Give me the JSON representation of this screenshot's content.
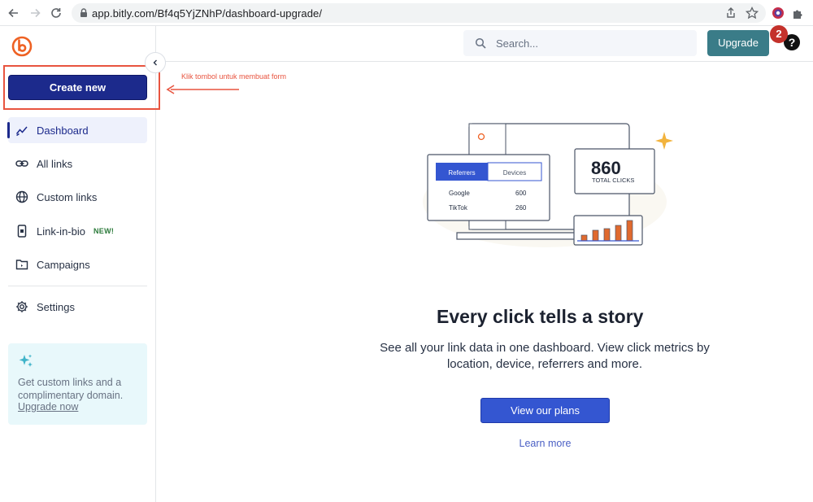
{
  "browser": {
    "url": "app.bitly.com/Bf4q5YjZNhP/dashboard-upgrade/"
  },
  "sidebar": {
    "create_label": "Create new",
    "collapse_icon": "chevron-left-icon",
    "items": [
      {
        "label": "Dashboard",
        "icon": "chart-trend-icon",
        "active": true
      },
      {
        "label": "All links",
        "icon": "link-icon"
      },
      {
        "label": "Custom links",
        "icon": "globe-icon"
      },
      {
        "label": "Link-in-bio",
        "icon": "phone-icon",
        "badge": "NEW!"
      },
      {
        "label": "Campaigns",
        "icon": "folder-icon"
      },
      {
        "label": "Settings",
        "icon": "gear-icon"
      }
    ],
    "promo": {
      "text": "Get custom links and a complimentary domain.",
      "link": "Upgrade now"
    }
  },
  "annotation": {
    "text": "Klik tombol untuk membuat form",
    "color": "#e8543f"
  },
  "header": {
    "search_placeholder": "Search...",
    "upgrade_label": "Upgrade",
    "notification_count": "2",
    "help_label": "?"
  },
  "illustration": {
    "tabs": [
      "Referrers",
      "Devices"
    ],
    "rows": [
      {
        "name": "Google",
        "value": "600"
      },
      {
        "name": "TikTok",
        "value": "260"
      }
    ],
    "total_clicks": "860",
    "total_clicks_label": "TOTAL CLICKS"
  },
  "main": {
    "headline": "Every click tells a story",
    "subtext": "See all your link data in one dashboard. View click metrics by location, device, referrers and more.",
    "plans_label": "View our plans",
    "learn_more": "Learn more"
  },
  "colors": {
    "brand_navy": "#1c2a8c",
    "upgrade_teal": "#3a7c88",
    "cta_blue": "#3456d1",
    "logo_orange": "#ee6123"
  }
}
